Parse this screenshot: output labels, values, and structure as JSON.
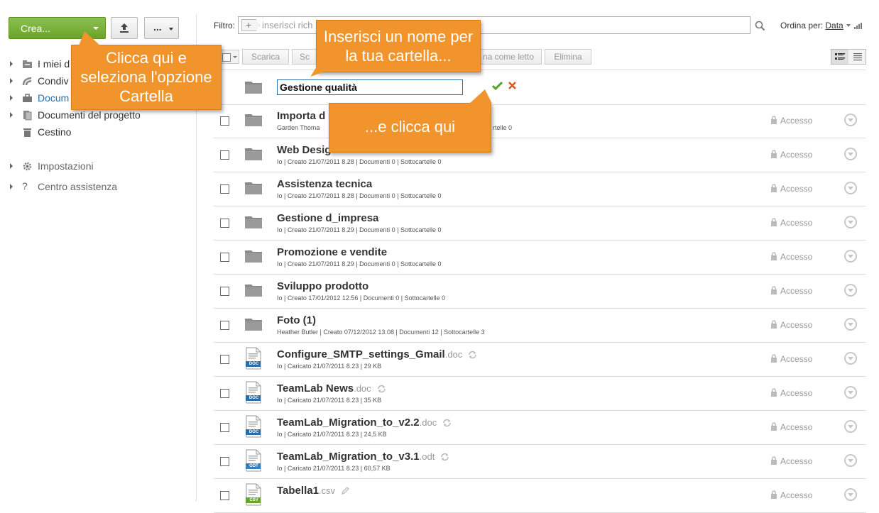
{
  "toolbar": {
    "create_label": "Crea...",
    "more_label": "...",
    "upload_icon": "upload-icon"
  },
  "sidebar": {
    "items": [
      {
        "label": "I miei d",
        "icon": "my-documents-icon"
      },
      {
        "label": "Condiv",
        "icon": "shared-icon"
      },
      {
        "label": "Docum",
        "icon": "common-documents-icon"
      },
      {
        "label": "Documenti del progetto",
        "icon": "project-documents-icon"
      },
      {
        "label": "Cestino",
        "icon": "trash-icon"
      }
    ],
    "settings_label": "Impostazioni",
    "help_label": "Centro assistenza"
  },
  "filter": {
    "label": "Filtro:",
    "placeholder": "inserisci rich",
    "sort_label": "Ordina per:",
    "sort_value": "Data"
  },
  "actions": {
    "download": "Scarica",
    "second": "Sc",
    "mark_read": "na come letto",
    "delete": "Elimina"
  },
  "new_folder": {
    "value": "Gestione qualità"
  },
  "rows": [
    {
      "title": "Importa d",
      "ext": "",
      "meta": "Garden Thoma",
      "meta_tail": "rtelle 0",
      "type": "folder",
      "access": "Accesso"
    },
    {
      "title": "Web Desig",
      "ext": "",
      "meta": "Io | Creato 21/07/2011 8.28 | Documenti 0 | Sottocartelle 0",
      "type": "folder",
      "access": "Accesso"
    },
    {
      "title": "Assistenza tecnica",
      "ext": "",
      "meta": "Io | Creato 21/07/2011 8.28 | Documenti 0 | Sottocartelle 0",
      "type": "folder",
      "access": "Accesso"
    },
    {
      "title": "Gestione d_impresa",
      "ext": "",
      "meta": "Io | Creato 21/07/2011 8.29 | Documenti 0 | Sottocartelle 0",
      "type": "folder",
      "access": "Accesso"
    },
    {
      "title": "Promozione e vendite",
      "ext": "",
      "meta": "Io | Creato 21/07/2011 8.29 | Documenti 0 | Sottocartelle 0",
      "type": "folder",
      "access": "Accesso"
    },
    {
      "title": "Sviluppo prodotto",
      "ext": "",
      "meta": "Io | Creato 17/01/2012 12.56 | Documenti 0 | Sottocartelle 0",
      "type": "folder",
      "access": "Accesso"
    },
    {
      "title": "Foto (1)",
      "ext": "",
      "meta": "Heather Butler | Creato 07/12/2012 13.08 | Documenti 12 | Sottocartelle 3",
      "type": "folder",
      "access": "Accesso"
    },
    {
      "title": "Configure_SMTP_settings_Gmail",
      "ext": ".doc",
      "meta": "Io | Caricato 21/07/2011 8.23 | 29 KB",
      "type": "doc",
      "badge": "DOC",
      "access": "Accesso"
    },
    {
      "title": "TeamLab News",
      "ext": ".doc",
      "meta": "Io | Caricato 21/07/2011 8.23 | 35 KB",
      "type": "doc",
      "badge": "DOC",
      "access": "Accesso"
    },
    {
      "title": "TeamLab_Migration_to_v2.2",
      "ext": ".doc",
      "meta": "Io | Caricato 21/07/2011 8.23 | 24,5 KB",
      "type": "doc",
      "badge": "DOC",
      "access": "Accesso"
    },
    {
      "title": "TeamLab_Migration_to_v3.1",
      "ext": ".odt",
      "meta": "Io | Caricato 21/07/2011 8.23 | 60,57 KB",
      "type": "doc",
      "badge": "ODT",
      "access": "Accesso"
    },
    {
      "title": "Tabella1",
      "ext": ".csv",
      "meta": "",
      "type": "csv",
      "badge": "CSV",
      "access": "Accesso"
    }
  ],
  "tooltips": {
    "create": "Clicca qui e seleziona l'opzione Cartella",
    "name": "Inserisci un nome per la tua cartella...",
    "confirm": "...e clicca qui"
  },
  "colors": {
    "create_button": "#7ab33e",
    "tooltip": "#f1942b",
    "active_link": "#2a6fa8",
    "doc_badge": "#2a6fa8",
    "csv_badge": "#6aa329"
  }
}
